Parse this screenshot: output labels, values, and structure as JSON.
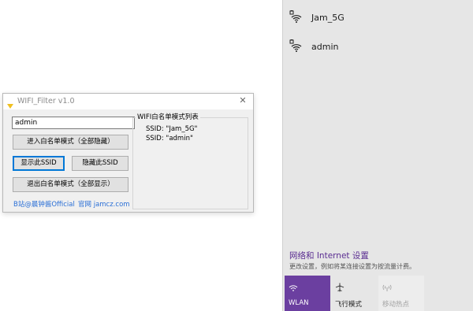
{
  "flyout": {
    "networks": [
      {
        "name": "Jam_5G",
        "icon": "wifi-secured-icon"
      },
      {
        "name": "admin",
        "icon": "wifi-secured-icon"
      }
    ],
    "settings_link": "网络和 Internet 设置",
    "settings_desc": "更改设置，例如将某连接设置为按流量计费。",
    "quick_actions": [
      {
        "label": "WLAN",
        "icon": "wifi-icon",
        "active": true
      },
      {
        "label": "飞行模式",
        "icon": "airplane-icon",
        "active": false
      },
      {
        "label": "移动热点",
        "icon": "hotspot-icon",
        "active": false
      }
    ],
    "accent_color": "#6b3fa0"
  },
  "app": {
    "title": "WIFI_Filter v1.0",
    "ssid_input_value": "admin",
    "buttons": {
      "enter_whitelist": "进入白名单模式（全部隐藏）",
      "show_ssid": "显示此SSID",
      "hide_ssid": "隐藏此SSID",
      "exit_whitelist": "退出白名单模式（全部显示）"
    },
    "links": {
      "bilibili": "B站@晨钟酱Official",
      "website": "官网 jamcz.com"
    },
    "whitelist": {
      "title": "WIFI白名单模式列表",
      "entries": [
        "SSID: \"Jam_5G\"",
        "SSID: \"admin\""
      ]
    },
    "link_color": "#2a6fd6",
    "focus_color": "#0078d7"
  }
}
